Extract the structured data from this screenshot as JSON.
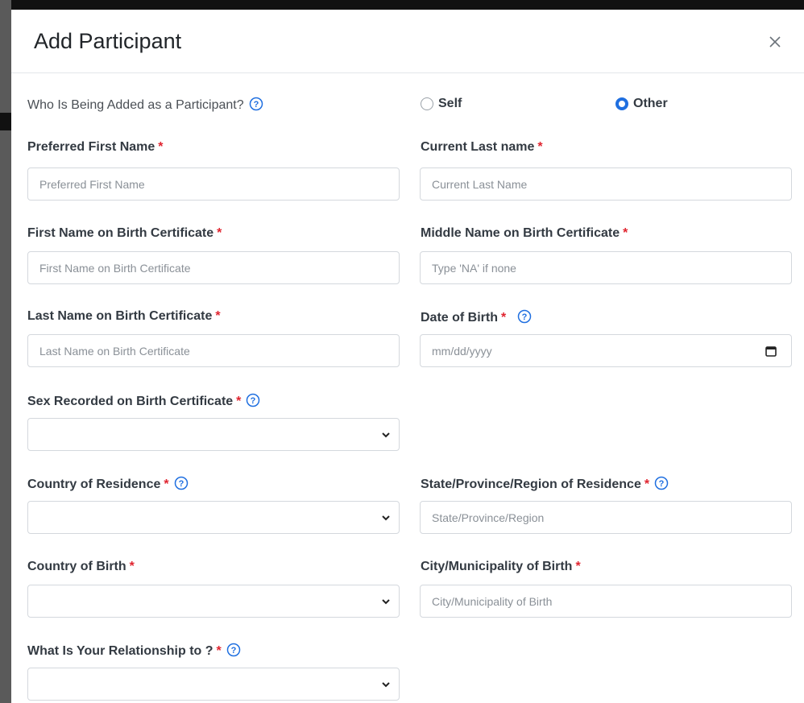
{
  "modal": {
    "title": "Add Participant",
    "close_icon": "close-icon"
  },
  "participant_type": {
    "question": "Who Is Being Added as a Participant?",
    "options": [
      {
        "label": "Self",
        "selected": false
      },
      {
        "label": "Other",
        "selected": true
      }
    ]
  },
  "fields": {
    "preferred_first_name": {
      "label": "Preferred First Name",
      "required_mark": "*",
      "placeholder": "Preferred First Name"
    },
    "current_last_name": {
      "label": "Current Last name",
      "required_mark": "*",
      "placeholder": "Current Last Name"
    },
    "birth_first_name": {
      "label": "First Name on Birth Certificate",
      "required_mark": "*",
      "placeholder": "First Name on Birth Certificate"
    },
    "birth_middle_name": {
      "label": "Middle Name on Birth Certificate",
      "required_mark": "*",
      "placeholder": "Type 'NA' if none"
    },
    "birth_last_name": {
      "label": "Last Name on Birth Certificate",
      "required_mark": "*",
      "placeholder": "Last Name on Birth Certificate"
    },
    "date_of_birth": {
      "label": "Date of Birth",
      "required_mark": "*",
      "placeholder": "mm/dd/yyyy"
    },
    "sex_on_birth_certificate": {
      "label": "Sex Recorded on Birth Certificate",
      "required_mark": "*",
      "value": ""
    },
    "country_of_residence": {
      "label": "Country of Residence",
      "required_mark": "*",
      "value": ""
    },
    "state_of_residence": {
      "label": "State/Province/Region of Residence",
      "required_mark": "*",
      "placeholder": "State/Province/Region"
    },
    "country_of_birth": {
      "label": "Country of Birth",
      "required_mark": "*",
      "value": ""
    },
    "city_of_birth": {
      "label": "City/Municipality of Birth",
      "required_mark": "*",
      "placeholder": "City/Municipality of Birth"
    },
    "relationship": {
      "label": "What Is Your Relationship to ?",
      "required_mark": "*",
      "value": ""
    }
  },
  "colors": {
    "required": "#e0242f",
    "accent": "#1f6fe0",
    "help_icon": "#1f6fe0"
  }
}
